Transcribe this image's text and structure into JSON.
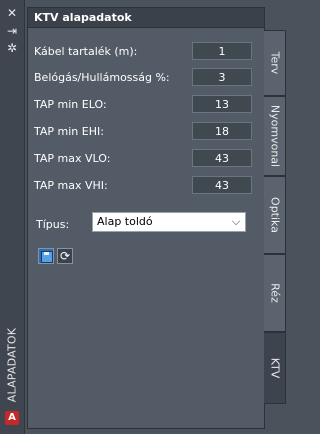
{
  "palette": {
    "title": "ALAPADATOK",
    "icons": [
      "close-icon",
      "pin-icon",
      "settings-icon"
    ]
  },
  "panel": {
    "title": "KTV alapadatok",
    "fields": [
      {
        "label": "Kábel tartalék (m):",
        "value": "1"
      },
      {
        "label": "Belógás/Hullámosság %:",
        "value": "3"
      },
      {
        "label": "TAP min ELO:",
        "value": "13"
      },
      {
        "label": "TAP min EHI:",
        "value": "18"
      },
      {
        "label": "TAP max VLO:",
        "value": "43"
      },
      {
        "label": "TAP max VHI:",
        "value": "43"
      }
    ],
    "type_label": "Típus:",
    "type_value": "Alap toldó"
  },
  "tabs": [
    {
      "label": "Terv",
      "active": false
    },
    {
      "label": "Nyomvonal",
      "active": false
    },
    {
      "label": "Optika",
      "active": false
    },
    {
      "label": "Réz",
      "active": false
    },
    {
      "label": "KTV",
      "active": true
    }
  ]
}
